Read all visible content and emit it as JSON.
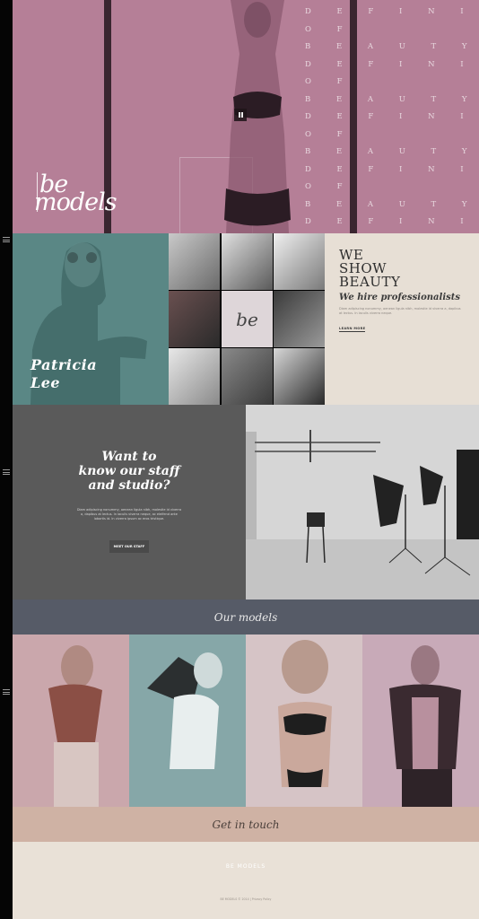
{
  "hero": {
    "logo_line1": "be",
    "logo_line2": "models",
    "beauty_rows": [
      "D E F I N I T I O N",
      "O F",
      "B E A U T Y",
      "D E F I N I T I O N",
      "O F",
      "B E A U T Y",
      "D E F I N I T I O N",
      "O F",
      "B E A U T Y",
      "D E F I N I T I O N",
      "O F",
      "B E A U T Y",
      "D E F I N I T I O N"
    ]
  },
  "feature": {
    "name_line1": "Patricia",
    "name_line2": "Lee"
  },
  "grid": {
    "logo": "be"
  },
  "intro": {
    "title_line1": "WE",
    "title_line2": "SHOW",
    "title_line3": "BEAUTY",
    "subtitle": "We hire professionalists",
    "text": "Diam adipiscing nonummy, aenean ligula nibh, molestie id viverra a, dapibus at lectus. In iaculis viverra neque.",
    "link": "LEARN MORE"
  },
  "staff": {
    "title_line1": "Want to",
    "title_line2": "know our staff",
    "title_line3": "and studio?",
    "text": "Diam adipiscing nonummy, aenean ligula nibh, molestie id viverra a, dapibus at lectus. In iaculis viverra neque, ac eleifend ante lobortis id. In viverra ipsum ac eros tristique.",
    "button": "MEET OUR STAFF"
  },
  "models": {
    "heading": "Our models"
  },
  "contact": {
    "heading": "Get in touch"
  },
  "footer": {
    "logo": "BE MODELS",
    "copyright": "BE MODELS © 2014 | Privacy Policy"
  },
  "colors": {
    "hero": "#b57f97",
    "feature": "#5a8785",
    "intro": "#e7dfd5",
    "staff": "#5a5a5a",
    "models_bar": "#565b67",
    "touch_bar": "#cfb2a4",
    "footer": "#e9e1d7"
  }
}
